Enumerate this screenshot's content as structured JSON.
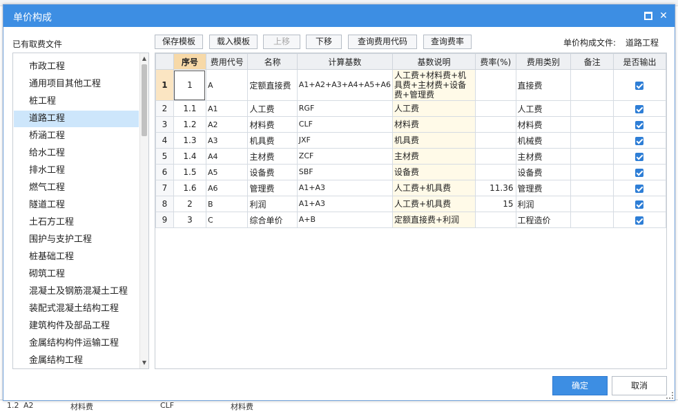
{
  "dialog": {
    "title": "单价构成",
    "max_glyph": "□",
    "close_glyph": "✕",
    "left_label": "已有取费文件",
    "file_label": "单价构成文件:",
    "file_value": "道路工程",
    "ok_label": "确定",
    "cancel_label": "取消"
  },
  "toolbar": {
    "save_template": "保存模板",
    "load_template": "载入模板",
    "move_up": "上移",
    "move_down": "下移",
    "query_fee_code": "查询费用代码",
    "query_fee_rate": "查询费率"
  },
  "fee_files": [
    "市政工程",
    "通用项目其他工程",
    "桩工程",
    "道路工程",
    "桥涵工程",
    "给水工程",
    "排水工程",
    "燃气工程",
    "隧道工程",
    "土石方工程",
    "围护与支护工程",
    "桩基础工程",
    "砌筑工程",
    "混凝土及钢筋混凝土工程",
    "装配式混凝土结构工程",
    "建筑构件及部品工程",
    "金属结构构件运输工程",
    "金属结构工程"
  ],
  "selected_fee_file": "道路工程",
  "grid": {
    "columns": [
      "",
      "序号",
      "费用代号",
      "名称",
      "计算基数",
      "基数说明",
      "费率(%)",
      "费用类别",
      "备注",
      "是否输出"
    ],
    "rows": [
      {
        "n": "1",
        "seq": "1",
        "code": "A",
        "name": "定额直接费",
        "base": "A1+A2+A3+A4+A5+A6",
        "desc": "人工费+材料费+机具费+主材费+设备费+管理费",
        "rate": "",
        "category": "直接费",
        "note": "",
        "output": true
      },
      {
        "n": "2",
        "seq": "1.1",
        "code": "A1",
        "name": "人工费",
        "base": "RGF",
        "desc": "人工费",
        "rate": "",
        "category": "人工费",
        "note": "",
        "output": true
      },
      {
        "n": "3",
        "seq": "1.2",
        "code": "A2",
        "name": "材料费",
        "base": "CLF",
        "desc": "材料费",
        "rate": "",
        "category": "材料费",
        "note": "",
        "output": true
      },
      {
        "n": "4",
        "seq": "1.3",
        "code": "A3",
        "name": "机具费",
        "base": "JXF",
        "desc": "机具费",
        "rate": "",
        "category": "机械费",
        "note": "",
        "output": true
      },
      {
        "n": "5",
        "seq": "1.4",
        "code": "A4",
        "name": "主材费",
        "base": "ZCF",
        "desc": "主材费",
        "rate": "",
        "category": "主材费",
        "note": "",
        "output": true
      },
      {
        "n": "6",
        "seq": "1.5",
        "code": "A5",
        "name": "设备费",
        "base": "SBF",
        "desc": "设备费",
        "rate": "",
        "category": "设备费",
        "note": "",
        "output": true
      },
      {
        "n": "7",
        "seq": "1.6",
        "code": "A6",
        "name": "管理费",
        "base": "A1+A3",
        "desc": "人工费+机具费",
        "rate": "11.36",
        "category": "管理费",
        "note": "",
        "output": true
      },
      {
        "n": "8",
        "seq": "2",
        "code": "B",
        "name": "利润",
        "base": "A1+A3",
        "desc": "人工费+机具费",
        "rate": "15",
        "category": "利润",
        "note": "",
        "output": true
      },
      {
        "n": "9",
        "seq": "3",
        "code": "C",
        "name": "综合单价",
        "base": "A+B",
        "desc": "定额直接费+利润",
        "rate": "",
        "category": "工程造价",
        "note": "",
        "output": true
      }
    ]
  },
  "background": {
    "bottom_seq": "1.2",
    "bottom_code": "A2",
    "bottom_name": "材料费",
    "bottom_base": "CLF",
    "bottom_desc": "材料费"
  }
}
